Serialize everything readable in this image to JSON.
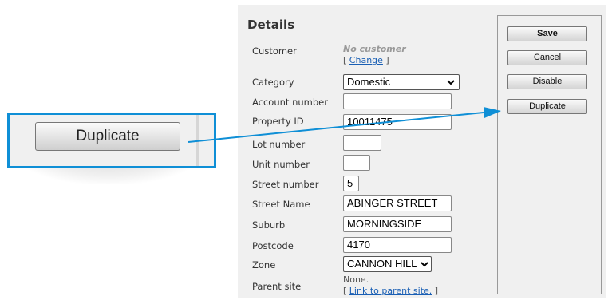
{
  "details": {
    "title": "Details",
    "customer": {
      "label": "Customer",
      "value": "No customer",
      "bracket_open": "[ ",
      "link": "Change",
      "bracket_close": " ]"
    },
    "category": {
      "label": "Category",
      "value": "Domestic"
    },
    "account_number": {
      "label": "Account number",
      "value": ""
    },
    "property_id": {
      "label": "Property ID",
      "value": "10011475"
    },
    "lot_number": {
      "label": "Lot number",
      "value": ""
    },
    "unit_number": {
      "label": "Unit number",
      "value": ""
    },
    "street_number": {
      "label": "Street number",
      "value": "5"
    },
    "street_name": {
      "label": "Street Name",
      "value": "ABINGER STREET"
    },
    "suburb": {
      "label": "Suburb",
      "value": "MORNINGSIDE"
    },
    "postcode": {
      "label": "Postcode",
      "value": "4170"
    },
    "zone": {
      "label": "Zone",
      "value": "CANNON HILL"
    },
    "parent_site": {
      "label": "Parent site",
      "value": "None.",
      "bracket_open": "[ ",
      "link": "Link to parent site.",
      "bracket_close": " ]"
    }
  },
  "actions": {
    "save": "Save",
    "cancel": "Cancel",
    "disable": "Disable",
    "duplicate": "Duplicate"
  },
  "callout": {
    "button_label": "Duplicate",
    "border_color": "#0f8fd6"
  },
  "icons": {
    "select_chevron": "chevron-down-icon",
    "callout_arrow": "arrow-icon"
  }
}
